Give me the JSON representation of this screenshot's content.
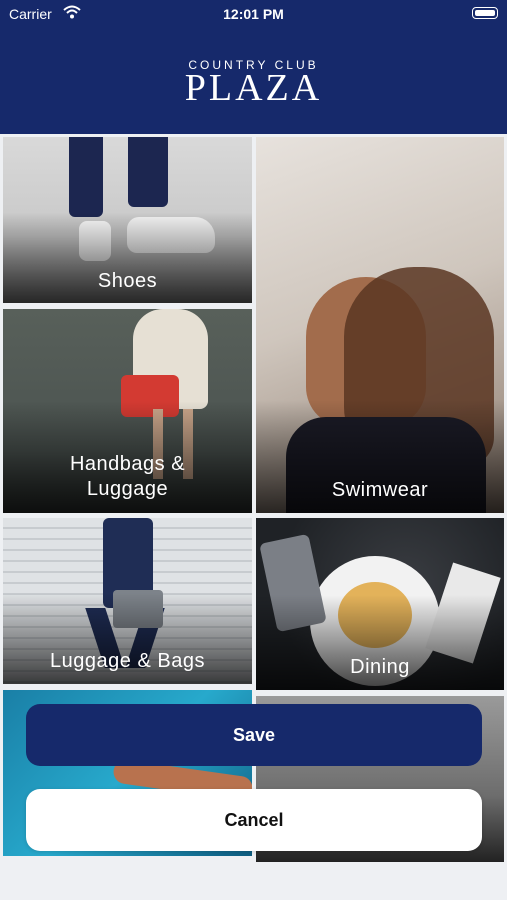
{
  "status_bar": {
    "carrier": "Carrier",
    "time": "12:01 PM"
  },
  "header": {
    "logo_top": "COUNTRY CLUB",
    "logo_main": "PLAZA"
  },
  "tiles": [
    {
      "label": "Shoes"
    },
    {
      "label": "Swimwear"
    },
    {
      "label_line1": "Handbags &",
      "label_line2": "Luggage"
    },
    {
      "label": "Luggage & Bags"
    },
    {
      "label": "Dining"
    }
  ],
  "actions": {
    "save": "Save",
    "cancel": "Cancel"
  },
  "colors": {
    "brand": "#16296b",
    "background": "#eef0f3"
  }
}
